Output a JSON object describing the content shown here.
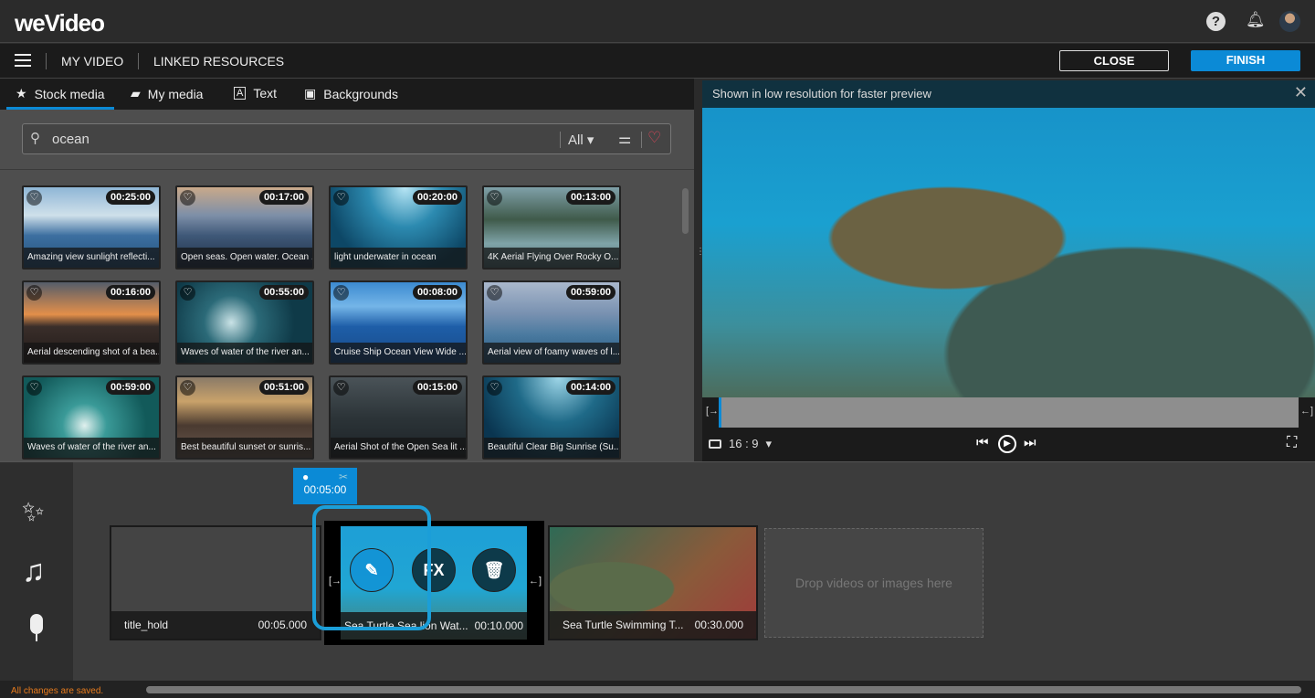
{
  "app": {
    "logo": "weVideo"
  },
  "header": {
    "help_icon": "help-icon",
    "bell_icon": "bell-icon"
  },
  "nav": {
    "my_video": "MY VIDEO",
    "linked_resources": "LINKED RESOURCES",
    "close": "CLOSE",
    "finish": "FINISH",
    "finish_color": "#0b8ad6"
  },
  "tabs": [
    {
      "label": "Stock media",
      "icon": "star-icon"
    },
    {
      "label": "My media",
      "icon": "folder-star-icon"
    },
    {
      "label": "Text",
      "icon": "text-icon"
    },
    {
      "label": "Backgrounds",
      "icon": "image-icon"
    }
  ],
  "search": {
    "value": "ocean",
    "filter": "All"
  },
  "media": [
    {
      "title": "Amazing view sunlight reflecti...",
      "duration": "00:25:00"
    },
    {
      "title": "Open seas. Open water. Ocean ...",
      "duration": "00:17:00"
    },
    {
      "title": "light underwater in ocean",
      "duration": "00:20:00"
    },
    {
      "title": "4K Aerial Flying Over Rocky O...",
      "duration": "00:13:00"
    },
    {
      "title": "Aerial descending shot of a bea...",
      "duration": "00:16:00"
    },
    {
      "title": "Waves of water of the river an...",
      "duration": "00:55:00"
    },
    {
      "title": "Cruise Ship Ocean View Wide ...",
      "duration": "00:08:00"
    },
    {
      "title": "Aerial view of foamy waves of l...",
      "duration": "00:59:00"
    },
    {
      "title": "Waves of water of the river an...",
      "duration": "00:59:00"
    },
    {
      "title": "Best beautiful sunset or sunris...",
      "duration": "00:51:00"
    },
    {
      "title": "Aerial Shot of the Open Sea lit ...",
      "duration": "00:15:00"
    },
    {
      "title": "Beautiful Clear Big Sunrise (Su...",
      "duration": "00:14:00"
    }
  ],
  "preview": {
    "notice": "Shown in low resolution for faster preview",
    "aspect": "16 : 9"
  },
  "timeline": {
    "playhead": "00:05:00",
    "clips": [
      {
        "title": "title_hold",
        "duration": "00:05.000"
      },
      {
        "title": "Sea Turtle Sea lion Wat...",
        "duration": "00:10.000"
      },
      {
        "title": "Sea Turtle Swimming T...",
        "duration": "00:30.000"
      }
    ],
    "drop": "Drop videos or images here",
    "fx": "FX"
  },
  "status": "All changes are saved."
}
